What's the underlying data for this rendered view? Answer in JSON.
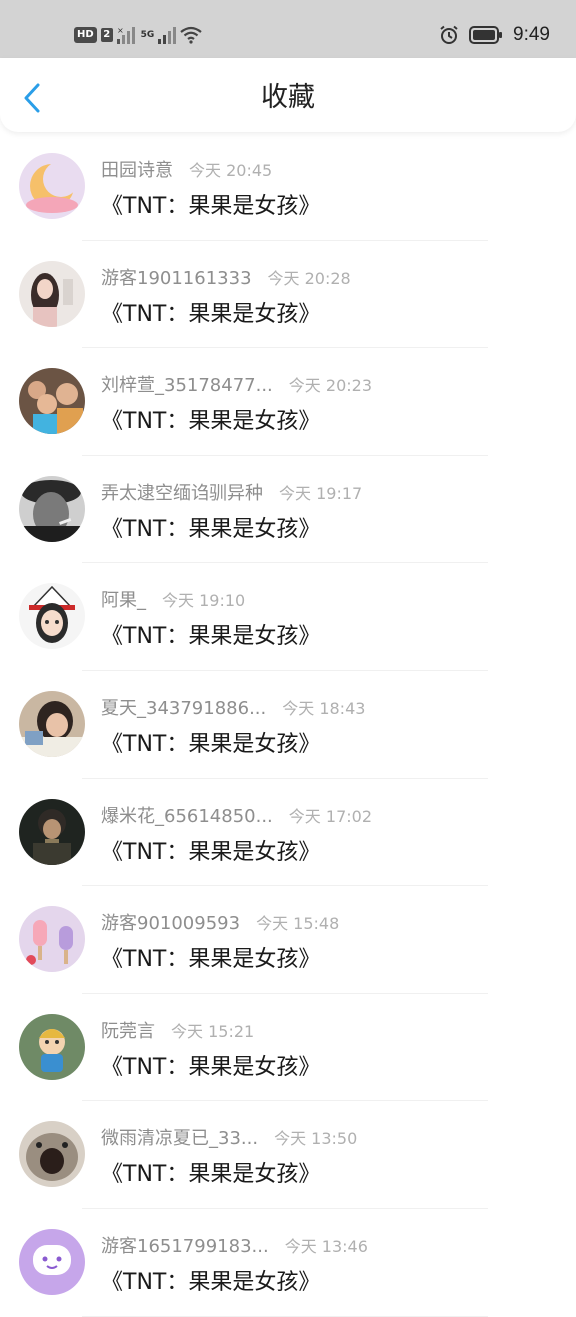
{
  "status_bar": {
    "hd": "HD",
    "sim1": "2",
    "sim2_label": "5G",
    "time": "9:49"
  },
  "nav": {
    "title": "收藏",
    "back_icon": "chevron-left-icon",
    "accent_color": "#2a9ee8"
  },
  "items": [
    {
      "user": "田园诗意",
      "time": "今天 20:45",
      "title": "《TNT：果果是女孩》",
      "avatar": "moon-avatar"
    },
    {
      "user": "游客1901161333",
      "time": "今天 20:28",
      "title": "《TNT：果果是女孩》",
      "avatar": "girl-photo-avatar"
    },
    {
      "user": "刘梓萱_35178477...",
      "time": "今天 20:23",
      "title": "《TNT：果果是女孩》",
      "avatar": "family-photo-avatar"
    },
    {
      "user": "弄太逮空缅诌驯异种",
      "time": "今天 19:17",
      "title": "《TNT：果果是女孩》",
      "avatar": "bw-man-avatar"
    },
    {
      "user": "阿果_",
      "time": "今天 19:10",
      "title": "《TNT：果果是女孩》",
      "avatar": "anime-witch-avatar"
    },
    {
      "user": "夏天_343791886...",
      "time": "今天 18:43",
      "title": "《TNT：果果是女孩》",
      "avatar": "student-photo-avatar"
    },
    {
      "user": "爆米花_65614850...",
      "time": "今天 17:02",
      "title": "《TNT：果果是女孩》",
      "avatar": "dark-portrait-avatar"
    },
    {
      "user": "游客901009593",
      "time": "今天 15:48",
      "title": "《TNT：果果是女孩》",
      "avatar": "ice-cream-avatar"
    },
    {
      "user": "阮莞言",
      "time": "今天 15:21",
      "title": "《TNT：果果是女孩》",
      "avatar": "cartoon-kid-avatar"
    },
    {
      "user": "微雨清凉夏已_33...",
      "time": "今天 13:50",
      "title": "《TNT：果果是女孩》",
      "avatar": "screaming-cat-avatar"
    },
    {
      "user": "游客1651799183...",
      "time": "今天 13:46",
      "title": "《TNT：果果是女孩》",
      "avatar": "purple-face-avatar"
    }
  ]
}
